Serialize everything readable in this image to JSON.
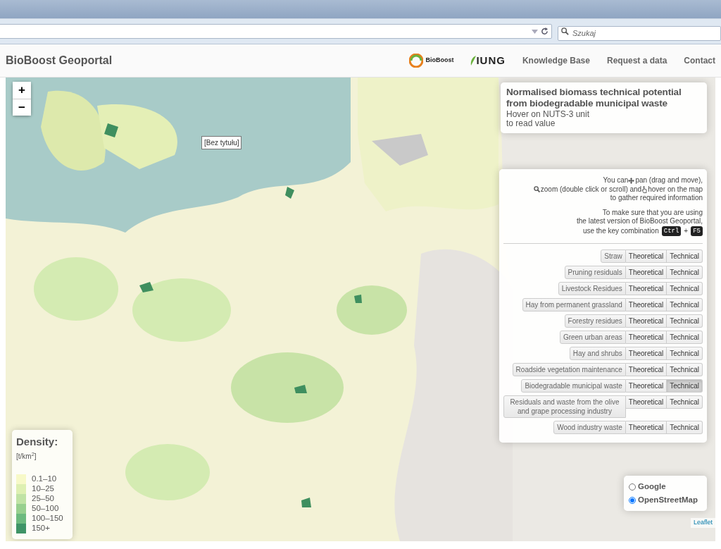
{
  "browser": {
    "search": {
      "placeholder": "Szukaj"
    }
  },
  "navbar": {
    "brand": "BioBoost Geoportal",
    "logos": [
      {
        "text": "BioBoost"
      },
      {
        "text": "IUNG"
      }
    ],
    "links": [
      "Knowledge Base",
      "Request a data",
      "Contact"
    ]
  },
  "map": {
    "zoom_controls": [
      "+",
      "−"
    ],
    "tooltip": "[Bez tytułu]",
    "title_panel": {
      "title": "Normalised biomass technical potential from biodegradable municipal waste",
      "subtitle_lines": [
        "Hover on NUTS-3 unit",
        "to read value"
      ]
    },
    "help": {
      "segments": [
        "You can",
        "pan (drag and move),",
        "zoom (double click or scroll) and",
        "hover on the map",
        "to gather required information"
      ],
      "update_lines": [
        "To make sure that you are using",
        "the latest version of BioBoost Geoportal,",
        "use the key combination"
      ],
      "keys": [
        "Ctrl",
        "F5"
      ],
      "key_joiner": "+"
    },
    "layers": [
      {
        "name": "Straw",
        "options": [
          {
            "label": "Theoretical",
            "selected": false
          },
          {
            "label": "Technical",
            "selected": false
          }
        ]
      },
      {
        "name": "Pruning residuals",
        "options": [
          {
            "label": "Theoretical",
            "selected": false
          },
          {
            "label": "Technical",
            "selected": false
          }
        ]
      },
      {
        "name": "Livestock Residues",
        "options": [
          {
            "label": "Theoretical",
            "selected": false
          },
          {
            "label": "Technical",
            "selected": false
          }
        ]
      },
      {
        "name": "Hay from permanent grassland",
        "options": [
          {
            "label": "Theoretical",
            "selected": false
          },
          {
            "label": "Technical",
            "selected": false
          }
        ]
      },
      {
        "name": "Forestry residues",
        "options": [
          {
            "label": "Theoretical",
            "selected": false
          },
          {
            "label": "Technical",
            "selected": false
          }
        ]
      },
      {
        "name": "Green urban areas",
        "options": [
          {
            "label": "Theoretical",
            "selected": false
          },
          {
            "label": "Technical",
            "selected": false
          }
        ]
      },
      {
        "name": "Hay and shrubs",
        "options": [
          {
            "label": "Theoretical",
            "selected": false
          },
          {
            "label": "Technical",
            "selected": false
          }
        ]
      },
      {
        "name": "Roadside vegetation maintenance",
        "options": [
          {
            "label": "Theoretical",
            "selected": false
          },
          {
            "label": "Technical",
            "selected": false
          }
        ]
      },
      {
        "name": "Biodegradable municipal waste",
        "options": [
          {
            "label": "Theoretical",
            "selected": false
          },
          {
            "label": "Technical",
            "selected": true
          }
        ]
      },
      {
        "name": "Residuals and waste from the olive and grape processing industry",
        "options": [
          {
            "label": "Theoretical",
            "selected": false
          },
          {
            "label": "Technical",
            "selected": false
          }
        ]
      },
      {
        "name": "Wood industry waste",
        "options": [
          {
            "label": "Theoretical",
            "selected": false
          },
          {
            "label": "Technical",
            "selected": false
          }
        ]
      }
    ],
    "legend": {
      "title": "Density:",
      "unit": "[t/km$^{2}$]",
      "items": [
        {
          "label": "0.1–10",
          "color": "#f7f9c8"
        },
        {
          "label": "10–25",
          "color": "#def0b2"
        },
        {
          "label": "25–50",
          "color": "#c0e3a5"
        },
        {
          "label": "50–100",
          "color": "#98d08f"
        },
        {
          "label": "100–150",
          "color": "#6dba7f"
        },
        {
          "label": "150+",
          "color": "#3f9467"
        }
      ]
    },
    "base_layers": [
      {
        "label": "Google",
        "selected": false
      },
      {
        "label": "OpenStreetMap",
        "selected": true
      }
    ],
    "attribution": "Leaflet"
  }
}
